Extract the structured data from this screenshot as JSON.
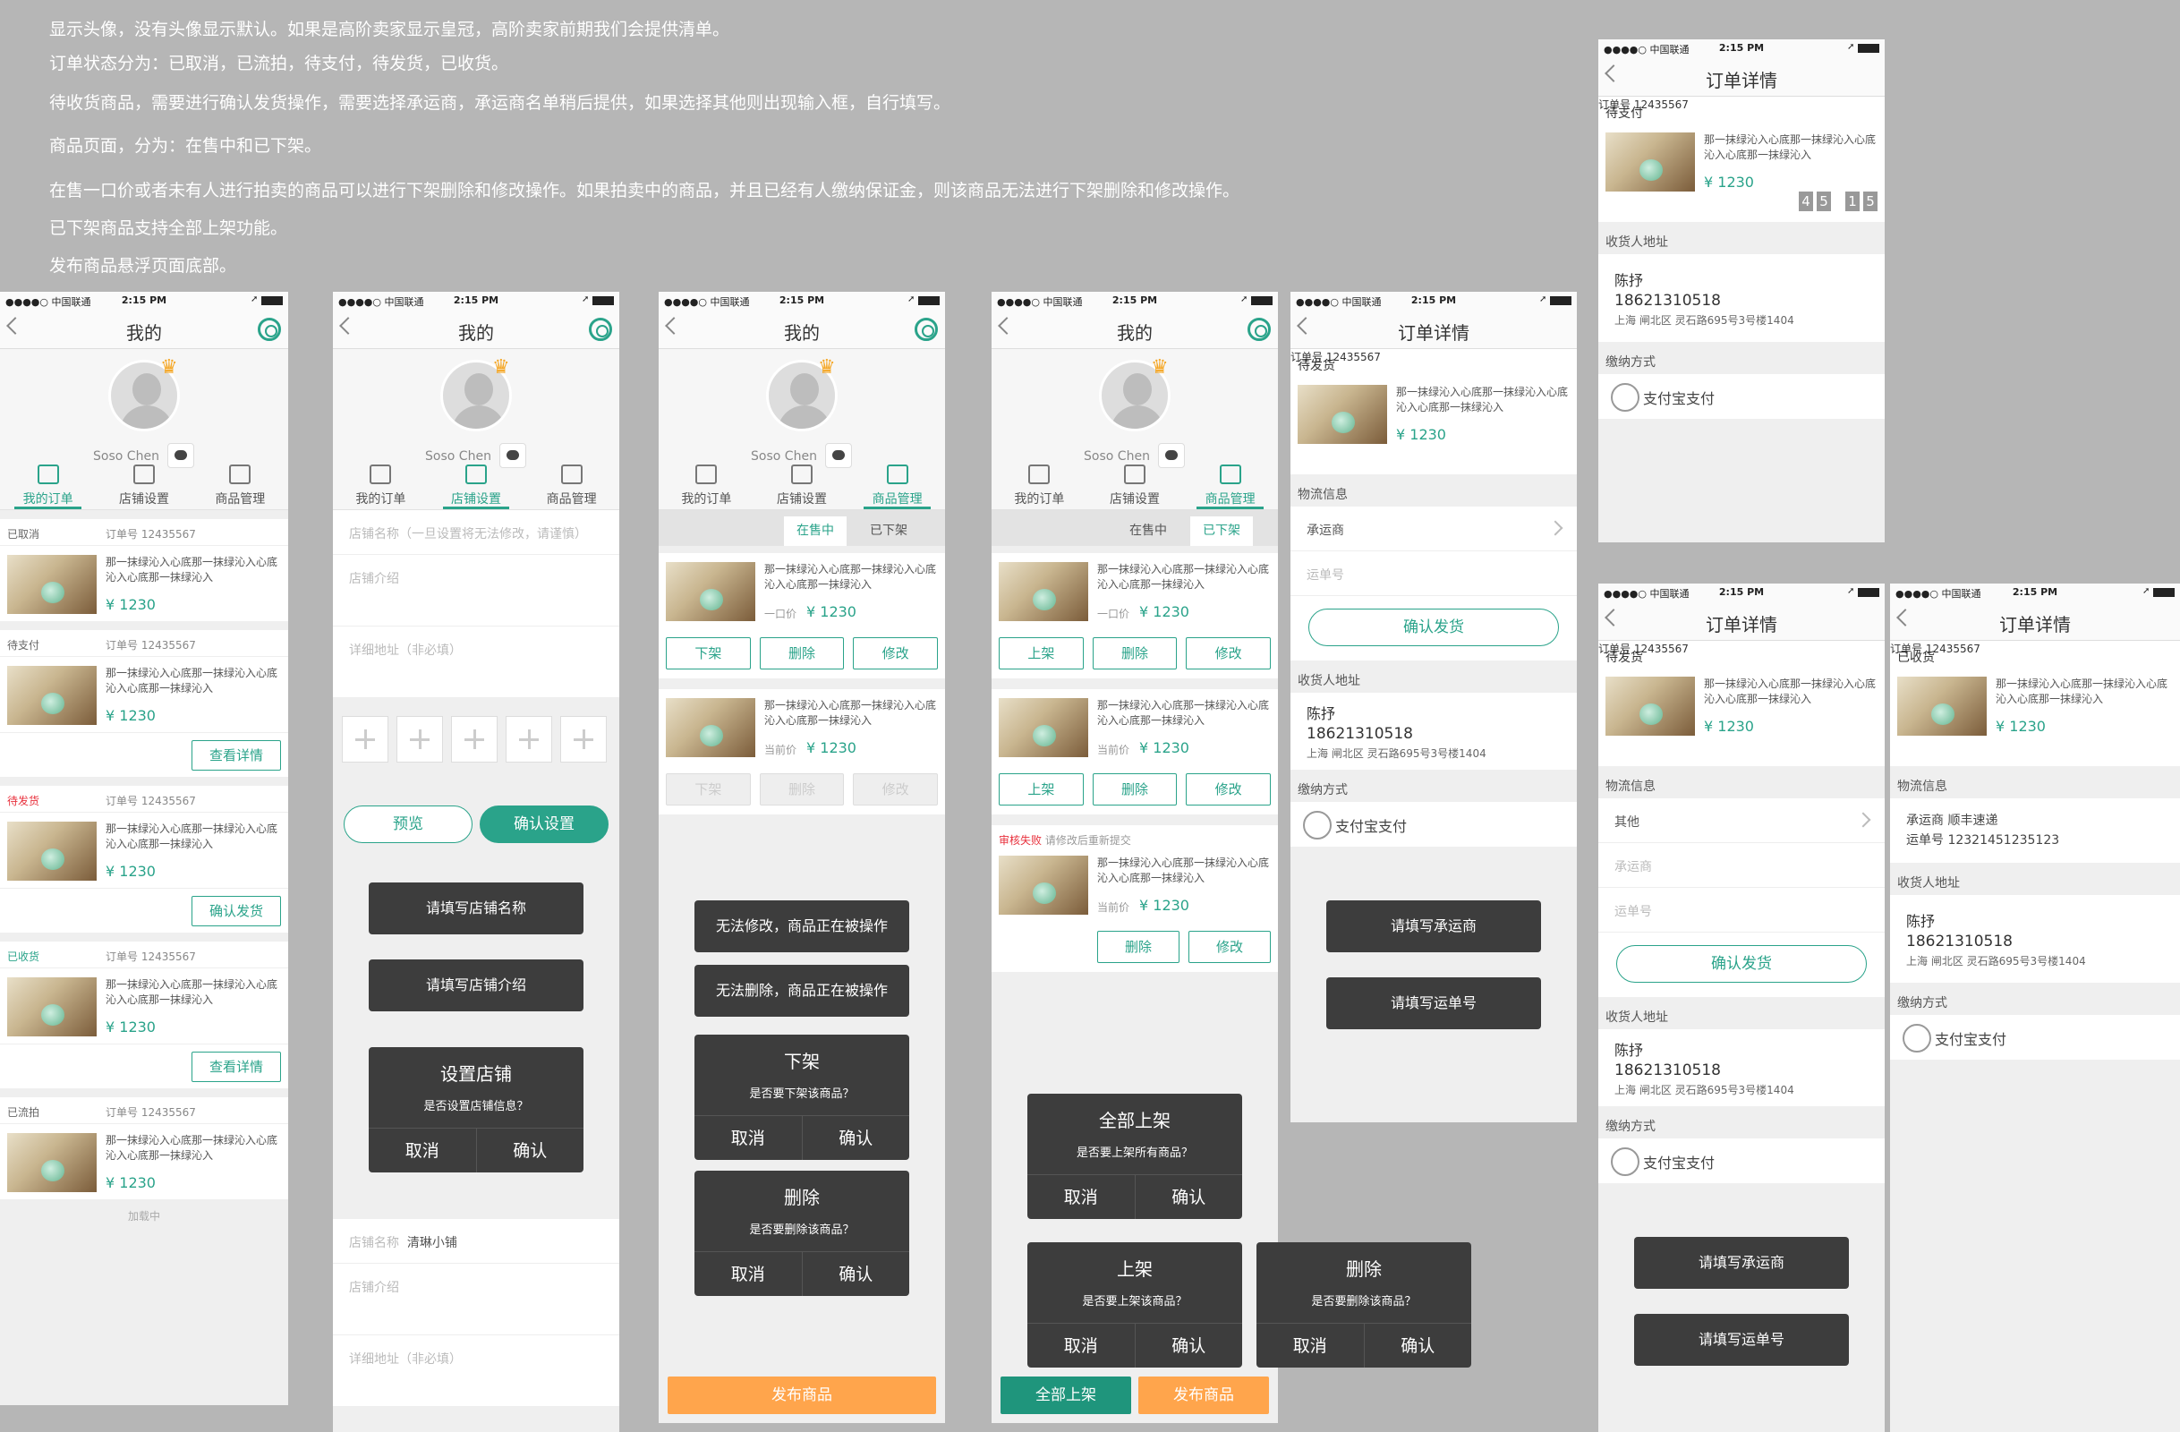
{
  "notes": [
    "显示头像，没有头像显示默认。如果是高阶卖家显示皇冠，高阶卖家前期我们会提供清单。",
    "订单状态分为：已取消，已流拍，待支付，待发货，已收货。",
    "待收货商品，需要进行确认发货操作，需要选择承运商，承运商名单稍后提供，如果选择其他则出现输入框，自行填写。",
    "商品页面，分为：在售中和已下架。",
    "在售一口价或者未有人进行拍卖的商品可以进行下架删除和修改操作。如果拍卖中的商品，并且已经有人缴纳保证金，则该商品无法进行下架删除和修改操作。",
    "已下架商品支持全部上架功能。",
    "发布商品悬浮页面底部。"
  ],
  "status": {
    "carrier": "●●●●○ 中国联通",
    "time": "2:15 PM"
  },
  "nav": {
    "mine": "我的",
    "order_detail": "订单详情"
  },
  "profile": {
    "name": "Soso Chen",
    "crown": "♛"
  },
  "tabs": {
    "orders": "我的订单",
    "shop": "店铺设置",
    "goods": "商品管理"
  },
  "product": {
    "desc": "那一抹绿沁入心底那一抹绿沁入心底沁入心底那一抹绿沁入",
    "price": "¥ 1230",
    "onum_label": "订单号",
    "onum": "订单号   12435567",
    "fixed_label": "一口价",
    "bid_label": "当前价"
  },
  "order_status": {
    "cancelled": "已取消",
    "unpaid": "待支付",
    "to_ship": "待发货",
    "received": "已收货",
    "failed": "已流拍"
  },
  "buttons": {
    "view_detail": "查看详情",
    "confirm_ship": "确认发货",
    "preview": "预览",
    "confirm_settings": "确认设置",
    "off_shelf": "下架",
    "delete": "删除",
    "edit": "修改",
    "on_shelf": "上架",
    "all_on_shelf": "全部上架",
    "publish": "发布商品",
    "cancel": "取消",
    "confirm": "确认"
  },
  "subtabs": {
    "on_sale": "在售中",
    "off_sale": "已下架"
  },
  "shop_form": {
    "name_placeholder": "店铺名称（一旦设置将无法修改，请谨慎）",
    "intro_placeholder": "店铺介绍",
    "addr_placeholder": "详细地址（非必填）",
    "name_label": "店铺名称",
    "name_value": "清琳小铺"
  },
  "toasts": {
    "fill_name": "请填写店铺名称",
    "fill_intro": "请填写店铺介绍",
    "cant_edit": "无法修改，商品正在被操作",
    "cant_delete": "无法删除，商品正在被操作",
    "fill_carrier": "请填写承运商",
    "fill_tracking": "请填写运单号"
  },
  "dialogs": {
    "set_shop": {
      "title": "设置店铺",
      "msg": "是否设置店铺信息？"
    },
    "off_shelf": {
      "title": "下架",
      "msg": "是否要下架该商品？"
    },
    "delete": {
      "title": "删除",
      "msg": "是否要删除该商品？"
    },
    "all_on": {
      "title": "全部上架",
      "msg": "是否要上架所有商品？"
    },
    "on_shelf": {
      "title": "上架",
      "msg": "是否要上架该商品？"
    }
  },
  "review": {
    "fail": "审核失败",
    "hint": "请修改后重新提交"
  },
  "detail": {
    "logistics": "物流信息",
    "carrier": "承运商",
    "tracking": "运单号",
    "other": "其他",
    "receiver_label": "收货人地址",
    "receiver_name": "陈抒",
    "receiver_phone": "18621310518",
    "receiver_addr": "上海 闸北区 灵石路695号3号楼1404",
    "payment_label": "缴纳方式",
    "payment": "支付宝支付",
    "carrier_value": "承运商  顺丰速递",
    "tracking_value": "运单号  12321451235123",
    "timer": [
      "4",
      "5",
      "1",
      "5"
    ]
  },
  "loadmore": "加载中",
  "colors": {
    "accent": "#2aa38a",
    "orange": "#ffa54c",
    "red": "#e8303c"
  }
}
